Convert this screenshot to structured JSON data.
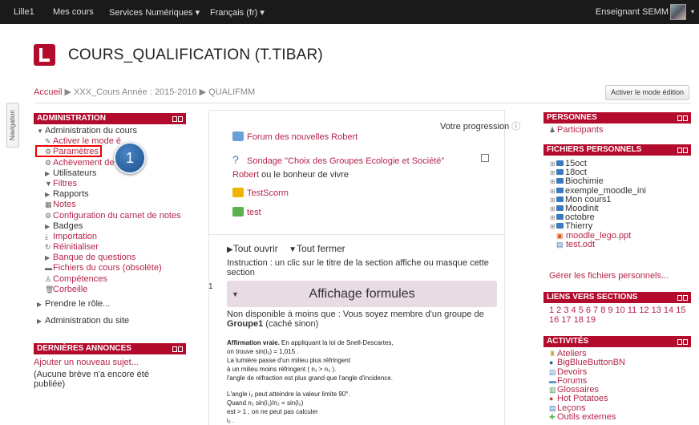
{
  "topbar": {
    "nav": [
      "Lille1",
      "Mes cours",
      "Services Numériques ▾",
      "Français (fr) ▾"
    ],
    "user": "Enseignant SEMM"
  },
  "header": {
    "course_title": "COURS_QUALIFICATION (T.TIBAR)",
    "breadcrumb": [
      "Accueil",
      "XXX_Cours Année : 2015-2016",
      "QUALIFMM"
    ],
    "edit_button": "Activer le mode édition"
  },
  "navtab": "Navigation",
  "admin": {
    "title": "ADMINISTRATION",
    "root": "Administration du cours",
    "items": [
      "Activer le mode é",
      "Paramètres",
      "Achèvement de",
      "Utilisateurs",
      "Filtres",
      "Rapports",
      "Notes",
      "Configuration du carnet de notes",
      "Badges",
      "Importation",
      "Réinitialiser",
      "Banque de questions",
      "Fichiers du cours (obsolète)",
      "Compétences",
      "Corbeille"
    ],
    "role": "Prendre le rôle...",
    "site": "Administration du site",
    "badge": "1"
  },
  "news": {
    "title": "DERNIÈRES ANNONCES",
    "add": "Ajouter un nouveau sujet...",
    "empty": "(Aucune brève n'a encore été publiée)"
  },
  "center": {
    "progress": "Votre progression",
    "activities": [
      "Forum des nouvelles Robert",
      "Sondage \"Choix des Groupes Ecologie et Société\"",
      "Robert ou le bonheur de vivre",
      "TestScorm",
      "test"
    ],
    "open_all": "Tout ouvrir",
    "close_all": "Tout fermer",
    "instruction": "Instruction : un clic sur le titre de la section affiche ou masque cette section",
    "section_number": "1",
    "section_title": "Affichage formules",
    "restriction_pre": "Non disponible à moins que : Vous soyez membre d'un groupe de",
    "restriction_group": "Groupe1",
    "restriction_post": "(caché sinon)",
    "formula_lines": [
      "Affirmation vraie. En appliquant la loi de Snell-Descartes,",
      "on trouve sin(i₂) = 1,015 .",
      "La lumière passe d'un milieu plus réfringent",
      "à un milieu moins réfringent ( n₁ > n₂ ).",
      "l'angle de réfraction est plus grand que l'angle d'incidence.",
      "L'angle i₂ peut atteindre la valeur limite 90°.",
      "Quand n₂ sin(i₁)/n₂ = sin(i₂)",
      "est > 1 , on ne peut pas calculer",
      "i₂ ."
    ]
  },
  "personnes": {
    "title": "PERSONNES",
    "participants": "Participants"
  },
  "files": {
    "title": "FICHIERS PERSONNELS",
    "folders": [
      "15oct",
      "18oct",
      "Biochimie",
      "exemple_moodle_ini",
      "Mon cours1",
      "Moodinit",
      "octobre",
      "Thierry"
    ],
    "sub": [
      "moodle_lego.ppt",
      "test.odt"
    ],
    "manage": "Gérer les fichiers personnels..."
  },
  "sections": {
    "title": "LIENS VERS SECTIONS",
    "line1": "1 2 3 4 5 6 7 8 9 10 11 12 13 14 15",
    "line2": "16 17 18 19"
  },
  "activities": {
    "title": "ACTIVITÉS",
    "items": [
      "Ateliers",
      "BigBlueButtonBN",
      "Devoirs",
      "Forums",
      "Glossaires",
      "Hot Potatoes",
      "Leçons",
      "Outils externes"
    ]
  },
  "colors": {
    "brand": "#b30b2c",
    "link": "#b5254a",
    "topbar": "#1a1a1a"
  }
}
